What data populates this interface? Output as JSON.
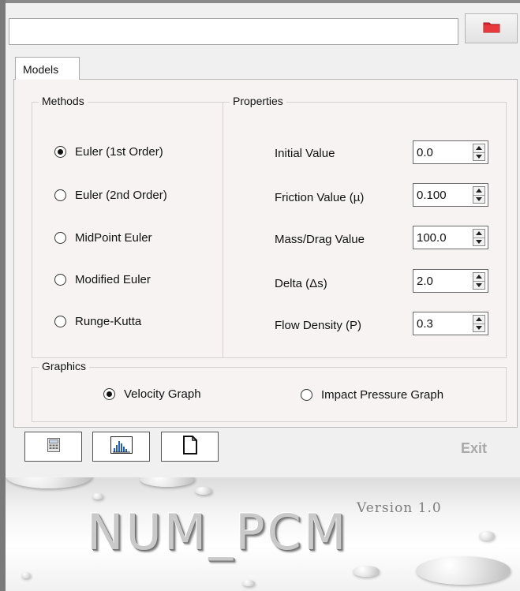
{
  "path_field": {
    "value": ""
  },
  "tabs": [
    {
      "label": "Models"
    }
  ],
  "methods": {
    "title": "Methods",
    "options": [
      {
        "label": "Euler (1st Order)",
        "checked": true
      },
      {
        "label": "Euler (2nd Order)",
        "checked": false
      },
      {
        "label": "MidPoint Euler",
        "checked": false
      },
      {
        "label": "Modified Euler",
        "checked": false
      },
      {
        "label": "Runge-Kutta",
        "checked": false
      }
    ]
  },
  "properties": {
    "title": "Properties",
    "items": [
      {
        "label": "Initial Value",
        "value": "0.0"
      },
      {
        "label": "Friction Value (µ)",
        "value": "0.100"
      },
      {
        "label": "Mass/Drag Value",
        "value": "100.0"
      },
      {
        "label": "Delta (Δs)",
        "value": "2.0"
      },
      {
        "label": "Flow Density (P)",
        "value": "0.3"
      }
    ]
  },
  "graphics": {
    "title": "Graphics",
    "options": [
      {
        "label": "Velocity Graph",
        "checked": true
      },
      {
        "label": "Impact Pressure Graph",
        "checked": false
      }
    ]
  },
  "toolbar": {
    "buttons": [
      {
        "icon": "calculator-icon"
      },
      {
        "icon": "bar-chart-icon"
      },
      {
        "icon": "document-icon"
      }
    ],
    "exit_label": "Exit"
  },
  "splash": {
    "brand": "NUM_PCM",
    "version": "Version 1.0"
  },
  "colors": {
    "folder": "#d9262c",
    "panel": "#f7f3f3",
    "exit_text": "#a9a9a9"
  }
}
